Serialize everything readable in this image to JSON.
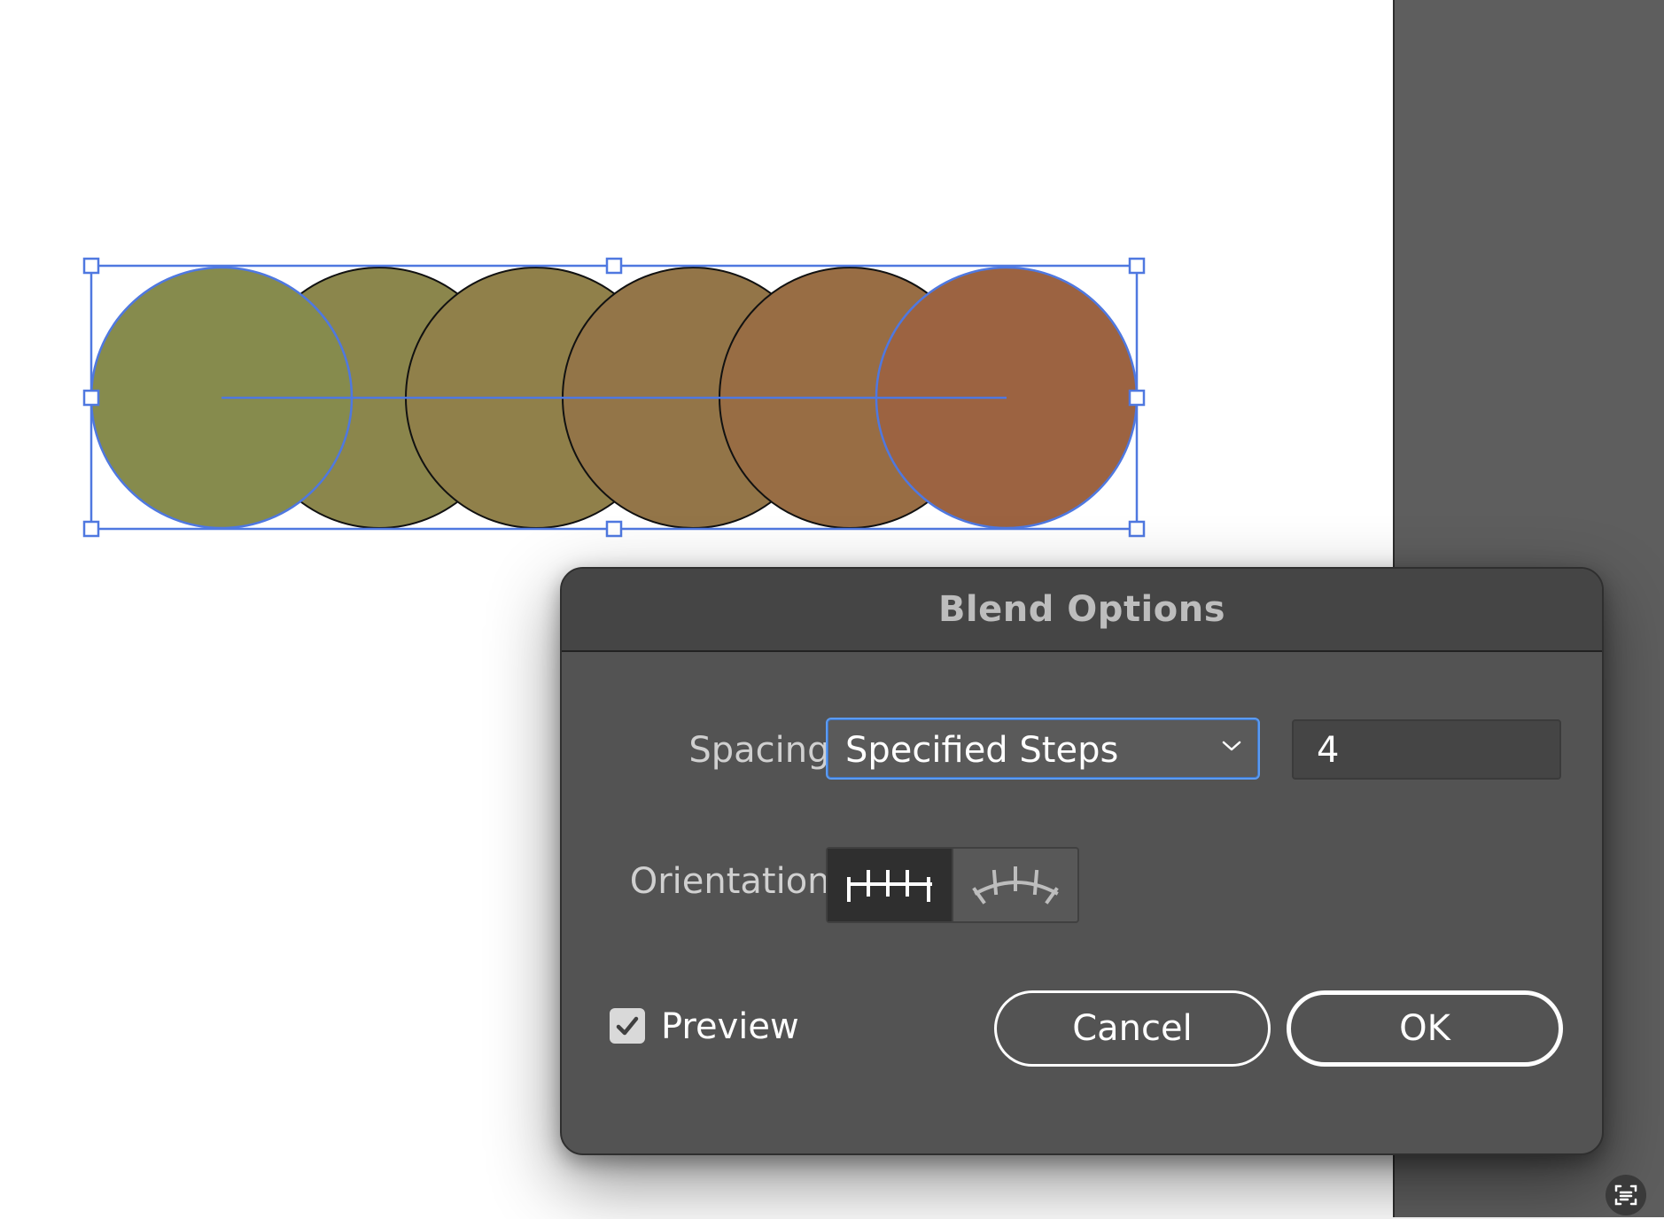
{
  "canvas": {
    "blend_objects": {
      "start_color": "#868b4d",
      "end_color": "#9c6341",
      "step_colors": [
        "#8b864c",
        "#90804a",
        "#937548",
        "#986d44"
      ]
    },
    "selection_color": "#4f78e0"
  },
  "dialog": {
    "title": "Blend Options",
    "spacing": {
      "label": "Spacing:",
      "selected_option": "Specified Steps",
      "steps_value": "4"
    },
    "orientation": {
      "label": "Orientation:",
      "options": [
        {
          "name": "align-to-page",
          "icon": "align-to-page-icon",
          "selected": true
        },
        {
          "name": "align-to-path",
          "icon": "align-to-path-icon",
          "selected": false
        }
      ]
    },
    "preview": {
      "label": "Preview",
      "checked": true
    },
    "buttons": {
      "cancel": "Cancel",
      "ok": "OK"
    }
  },
  "colors": {
    "dialog_bg": "#535353",
    "titlebar_bg": "#454545",
    "focus_ring": "#5b9bf2",
    "pasteboard": "#5e5e5e"
  }
}
